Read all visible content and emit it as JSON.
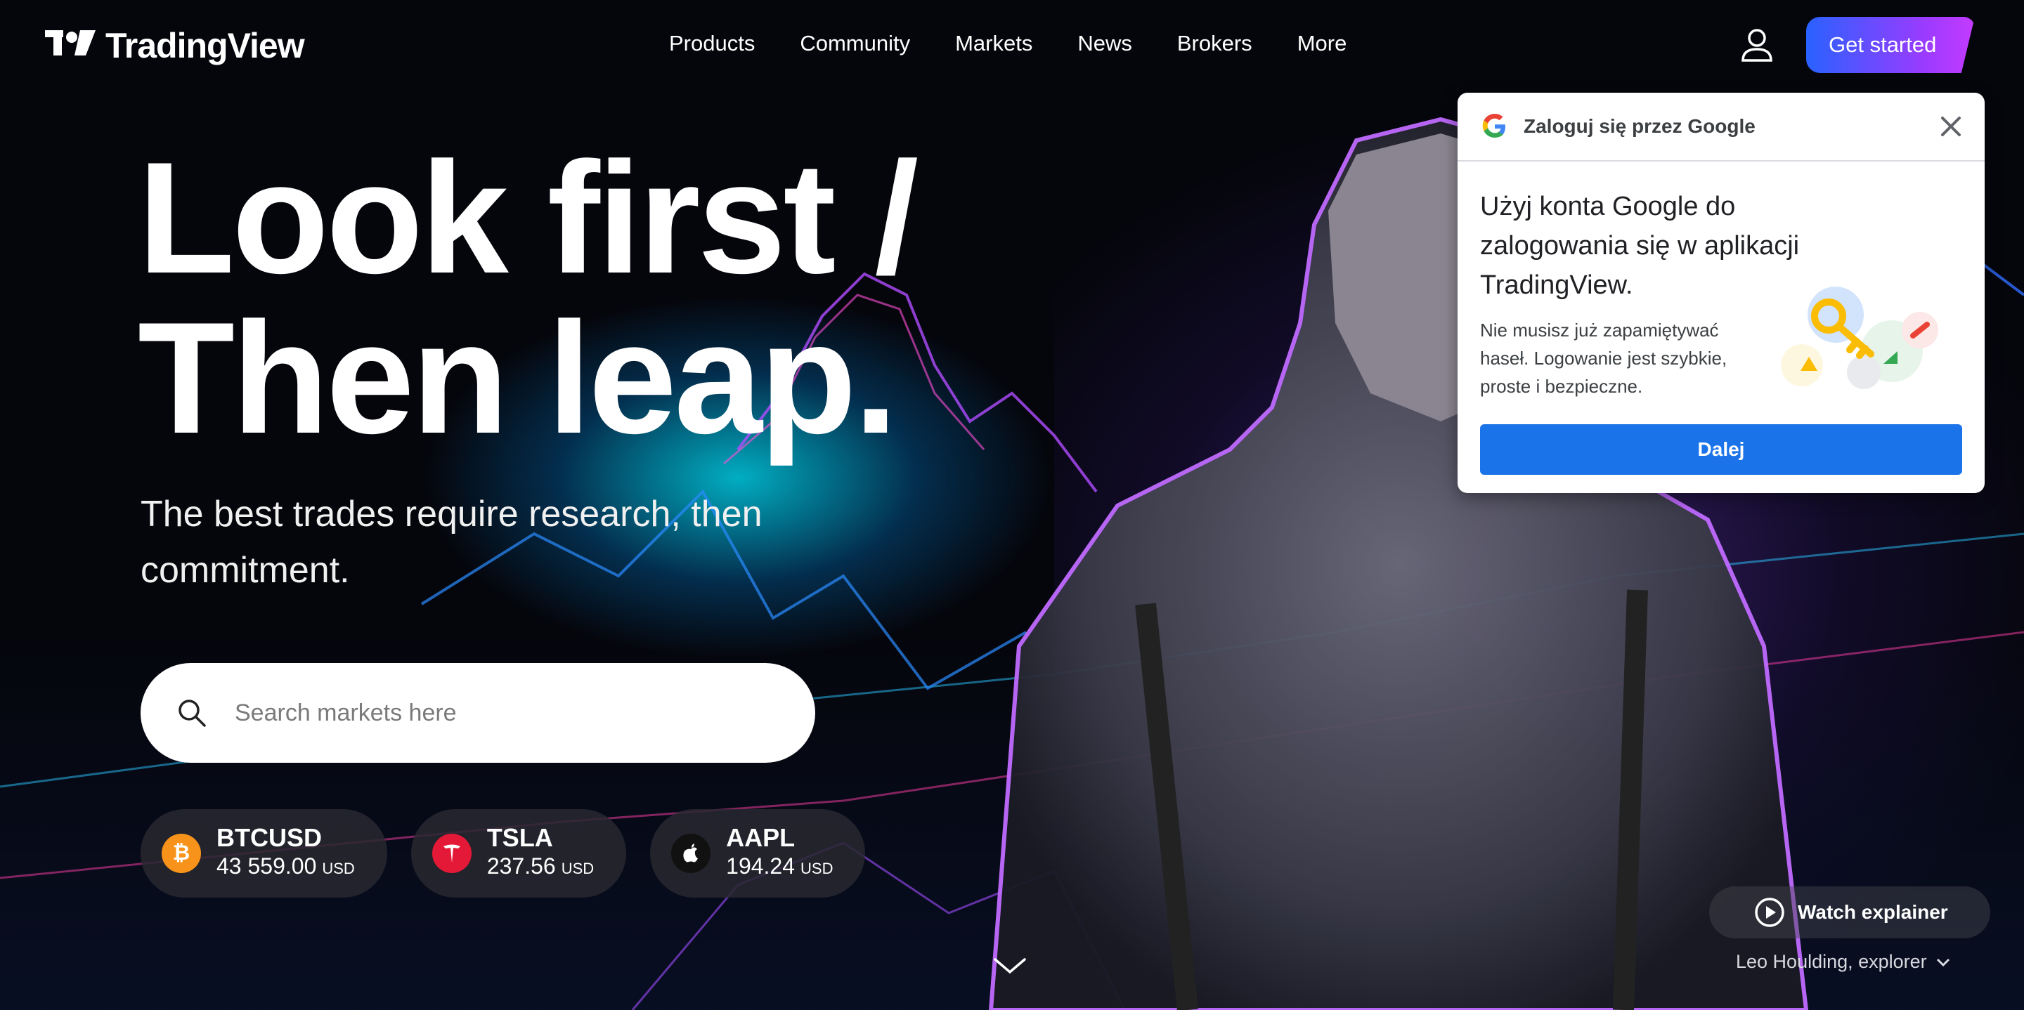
{
  "brand": {
    "name": "TradingView"
  },
  "nav": {
    "items": [
      {
        "label": "Products"
      },
      {
        "label": "Community"
      },
      {
        "label": "Markets"
      },
      {
        "label": "News"
      },
      {
        "label": "Brokers"
      },
      {
        "label": "More"
      }
    ],
    "cta_label": "Get started"
  },
  "hero": {
    "title_line1": "Look first /",
    "title_line2": "Then leap.",
    "subtitle": "The best trades require research, then commitment.",
    "search_placeholder": "Search markets here"
  },
  "tickers": [
    {
      "symbol": "BTCUSD",
      "price": "43 559.00",
      "currency": "USD",
      "icon": "bitcoin-icon",
      "color": "#f7931a"
    },
    {
      "symbol": "TSLA",
      "price": "237.56",
      "currency": "USD",
      "icon": "tesla-icon",
      "color": "#e31937"
    },
    {
      "symbol": "AAPL",
      "price": "194.24",
      "currency": "USD",
      "icon": "apple-icon",
      "color": "#111111"
    }
  ],
  "explainer": {
    "watch_label": "Watch explainer",
    "caption": "Leo Houlding, explorer"
  },
  "google_popup": {
    "header": "Zaloguj się przez Google",
    "title": "Użyj konta Google do zalogowania się w aplikacji TradingView.",
    "text": "Nie musisz już zapamiętywać haseł. Logowanie jest szybkie, proste i bezpieczne.",
    "button": "Dalej"
  },
  "colors": {
    "cta_gradient_start": "#2962ff",
    "cta_gradient_end": "#c43bff",
    "google_blue": "#1a73e8"
  }
}
